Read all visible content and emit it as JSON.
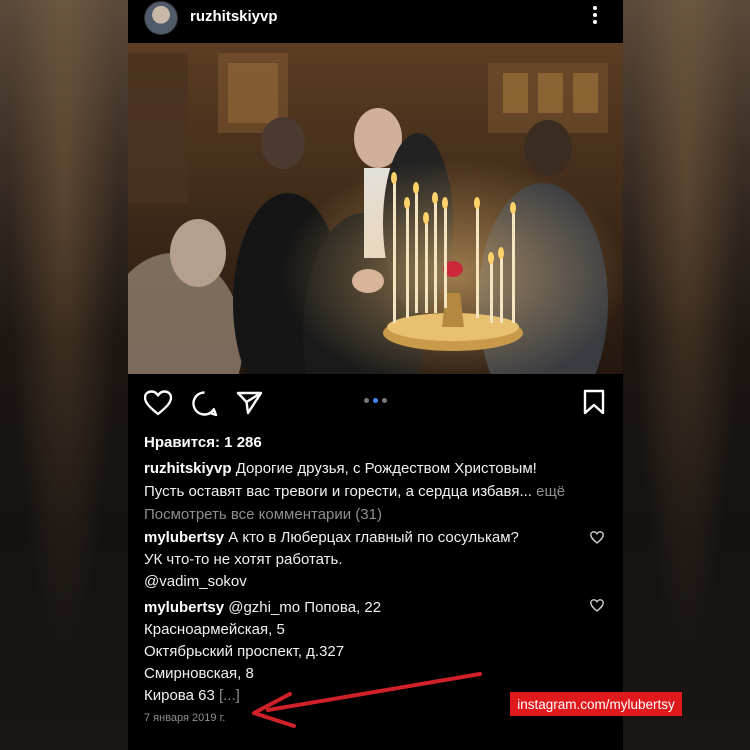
{
  "post": {
    "username": "ruzhitskiyvp",
    "likes_label": "Нравится: 1 286",
    "caption": {
      "author": "ruzhitskiyvp",
      "line1": "Дорогие друзья, с Рождеством Христовым!",
      "line2": "Пусть оставят вас тревоги и горести, а сердца избавя...",
      "more": "ещё"
    },
    "view_comments": "Посмотреть все комментарии (31)",
    "comments": [
      {
        "author": "mylubertsy",
        "lines": [
          "А кто в Люберцах главный по сосулькам?",
          "УК что-то не хотят работать.",
          "@vadim_sokov"
        ]
      },
      {
        "author": "mylubertsy",
        "lines": [
          "@gzhi_mo Попова, 22",
          "Красноармейская, 5",
          "Октябрьский проспект, д.327",
          "Смирновская, 8",
          "Кирова 63"
        ],
        "truncated": "[...]"
      }
    ],
    "date": "7 января 2019 г.",
    "carousel": {
      "count": 3,
      "active": 1
    }
  },
  "watermark": "instagram.com/mylubertsy",
  "icons": {
    "more": "more-vertical-icon",
    "like": "heart-icon",
    "comment": "comment-icon",
    "share": "send-icon",
    "save": "bookmark-icon"
  },
  "colors": {
    "background": "#000000",
    "accent_dot": "#3b8cf6",
    "arrow": "#d0202a",
    "watermark_bg": "#e0191c"
  }
}
